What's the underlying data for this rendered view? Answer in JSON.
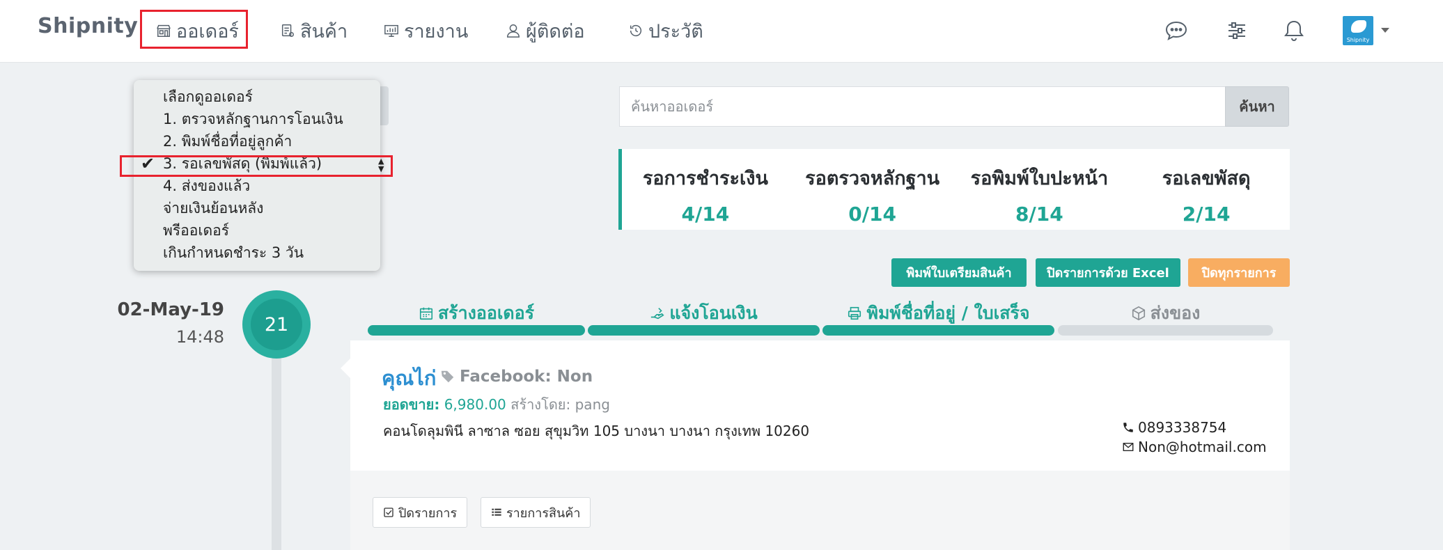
{
  "app": {
    "brand": "Shipnity"
  },
  "nav": {
    "items": [
      {
        "label": "ออเดอร์",
        "icon": "store-icon"
      },
      {
        "label": "สินค้า",
        "icon": "product-icon"
      },
      {
        "label": "รายงาน",
        "icon": "report-icon"
      },
      {
        "label": "ผู้ติดต่อ",
        "icon": "user-icon"
      },
      {
        "label": "ประวัติ",
        "icon": "history-icon"
      }
    ],
    "right_icons": [
      "chat-icon",
      "sliders-icon",
      "bell-icon"
    ],
    "avatar_text": "Shipnity",
    "highlight_color": "#e8222e"
  },
  "dropdown": {
    "options": [
      {
        "label": "เลือกดูออเดอร์",
        "selected": false
      },
      {
        "label": "1. ตรวจหลักฐานการโอนเงิน",
        "selected": false
      },
      {
        "label": "2. พิมพ์ชื่อที่อยู่ลูกค้า",
        "selected": false
      },
      {
        "label": "3. รอเลขพัสดุ (พิมพ์แล้ว)",
        "selected": true
      },
      {
        "label": "4. ส่งของแล้ว",
        "selected": false
      },
      {
        "label": "จ่ายเงินย้อนหลัง",
        "selected": false
      },
      {
        "label": "พรีออเดอร์",
        "selected": false
      },
      {
        "label": "เกินกำหนดชำระ 3 วัน",
        "selected": false
      }
    ],
    "check_mark": "✔"
  },
  "search": {
    "placeholder": "ค้นหาออเดอร์",
    "button_label": "ค้นหา"
  },
  "stats": [
    {
      "label": "รอการชำระเงิน",
      "value": "4/14"
    },
    {
      "label": "รอตรวจหลักฐาน",
      "value": "0/14"
    },
    {
      "label": "รอพิมพ์ใบปะหน้า",
      "value": "8/14"
    },
    {
      "label": "รอเลขพัสดุ",
      "value": "2/14"
    }
  ],
  "actions": {
    "print_prep": "พิมพ์ใบเตรียมสินค้า",
    "close_excel": "ปิดรายการด้วย Excel",
    "close_all": "ปิดทุกรายการ"
  },
  "colors": {
    "teal": "#1fa594",
    "orange": "#f8ad61",
    "blue_link": "#2d8fd1"
  },
  "order": {
    "date": "02-May-19",
    "time": "14:48",
    "number": "21",
    "steps": [
      {
        "label": "สร้างออเดอร์",
        "icon": "calendar-icon",
        "done": true
      },
      {
        "label": "แจ้งโอนเงิน",
        "icon": "payment-hand-icon",
        "done": true
      },
      {
        "label": "พิมพ์ชื่อที่อยู่ / ใบเสร็จ",
        "icon": "printer-icon",
        "done": true
      },
      {
        "label": "ส่งของ",
        "icon": "box-icon",
        "done": false
      }
    ],
    "customer_name": "คุณไก่",
    "channel": "Facebook: Non",
    "sales_label": "ยอดขาย:",
    "sales_value": "6,980.00",
    "created_by": "สร้างโดย: pang",
    "address": "คอนโดลุมพินี ลาซาล ซอย สุขุมวิท 105 บางนา บางนา กรุงเทพ 10260",
    "phone": "0893338754",
    "email": "Non@hotmail.com",
    "footer_buttons": {
      "close": "ปิดรายการ",
      "items": "รายการสินค้า"
    }
  }
}
